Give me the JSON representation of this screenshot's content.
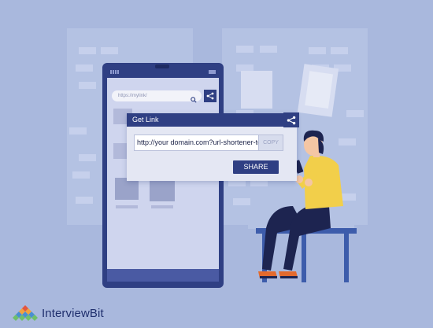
{
  "app": {
    "url_placeholder": "https://mylink/",
    "popup_title": "Get Link",
    "link_value": "http://your domain.com?url-shortener-tools",
    "copy_label": "COPY",
    "share_label": "SHARE"
  },
  "brand": {
    "name": "InterviewBit"
  },
  "colors": {
    "background": "#a9b8dd",
    "phone_frame": "#2f3f83",
    "screen": "#cfd5ee",
    "accent": "#2f3f83",
    "shirt": "#f2cf4a",
    "scissors": "#e3563f"
  },
  "icons": [
    "search-icon",
    "share-icon",
    "scissors-icon",
    "battery-icon",
    "logo-icon"
  ]
}
